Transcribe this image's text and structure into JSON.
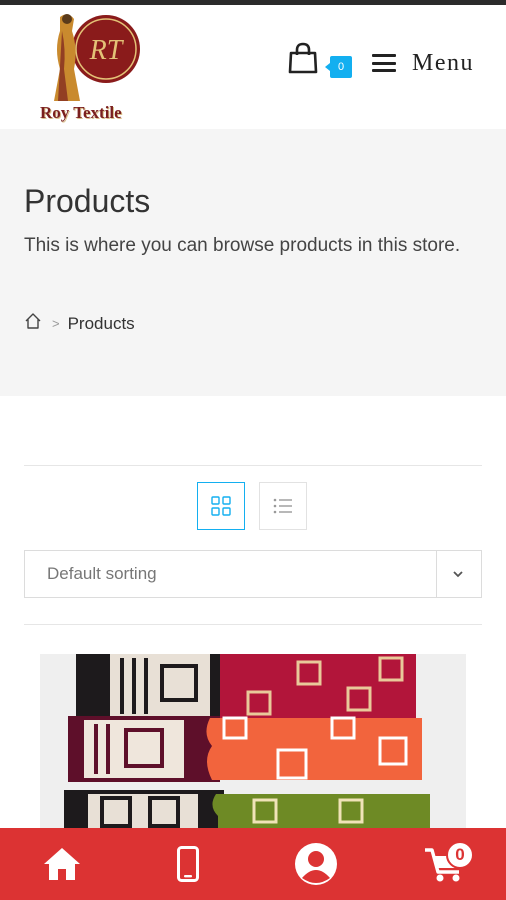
{
  "header": {
    "logo_monogram": "RT",
    "logo_text": "Roy Textile",
    "cart_badge_count": "0",
    "menu_label": "Menu"
  },
  "hero": {
    "title": "Products",
    "description": "This is where you can browse products in this store.",
    "breadcrumb": {
      "separator": ">",
      "current": "Products"
    }
  },
  "toolbar": {
    "sort_selected": "Default sorting",
    "active_view": "grid"
  },
  "bottom_nav": {
    "items": [
      "home-icon",
      "phone-icon",
      "account-icon",
      "cart-icon"
    ],
    "cart_count": "0"
  },
  "colors": {
    "accent": "#13aff0",
    "bottom_nav_bg": "#dc3333",
    "hero_bg": "#f5f5f5"
  }
}
